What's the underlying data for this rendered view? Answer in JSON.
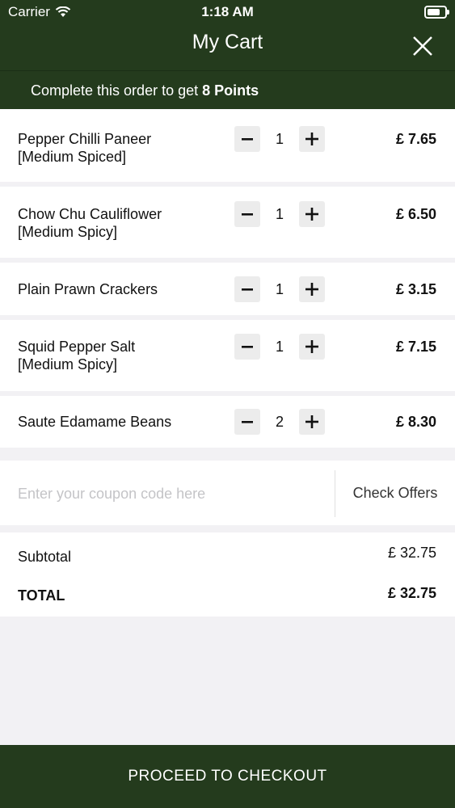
{
  "status_bar": {
    "carrier": "Carrier",
    "time": "1:18 AM",
    "battery_level": 0.75
  },
  "header": {
    "title": "My Cart",
    "close_icon": "close-icon"
  },
  "points_banner": {
    "prefix": "Complete this order to get ",
    "points": "8 Points"
  },
  "cart_items": [
    {
      "name_line1": "Pepper Chilli Paneer",
      "name_line2": "[Medium Spiced]",
      "quantity": "1",
      "price": "£ 7.65"
    },
    {
      "name_line1": "Chow Chu Cauliflower",
      "name_line2": "[Medium Spicy]",
      "quantity": "1",
      "price": "£ 6.50"
    },
    {
      "name_line1": "Plain Prawn Crackers",
      "name_line2": "",
      "quantity": "1",
      "price": "£ 3.15"
    },
    {
      "name_line1": "Squid Pepper Salt",
      "name_line2": "[Medium Spicy]",
      "quantity": "1",
      "price": "£ 7.15"
    },
    {
      "name_line1": "Saute Edamame Beans",
      "name_line2": "",
      "quantity": "2",
      "price": "£ 8.30"
    }
  ],
  "coupon": {
    "placeholder": "Enter your coupon code here",
    "value": "",
    "check_offers_label": "Check Offers"
  },
  "totals": {
    "subtotal_label": "Subtotal",
    "subtotal_value": "£ 32.75",
    "total_label": "TOTAL",
    "total_value": "£ 32.75"
  },
  "checkout": {
    "label": "PROCEED TO CHECKOUT"
  },
  "colors": {
    "brand_green": "#243b1d",
    "background": "#f2f1f4",
    "stepper_bg": "#ececec"
  }
}
